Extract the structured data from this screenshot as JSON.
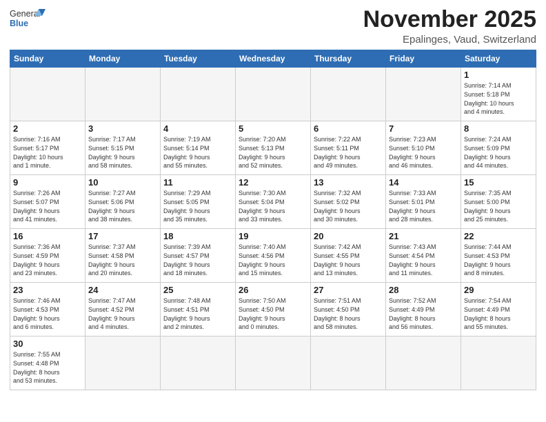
{
  "header": {
    "logo_general": "General",
    "logo_blue": "Blue",
    "month_title": "November 2025",
    "location": "Epalinges, Vaud, Switzerland"
  },
  "days_of_week": [
    "Sunday",
    "Monday",
    "Tuesday",
    "Wednesday",
    "Thursday",
    "Friday",
    "Saturday"
  ],
  "weeks": [
    [
      {
        "day": null,
        "info": ""
      },
      {
        "day": null,
        "info": ""
      },
      {
        "day": null,
        "info": ""
      },
      {
        "day": null,
        "info": ""
      },
      {
        "day": null,
        "info": ""
      },
      {
        "day": null,
        "info": ""
      },
      {
        "day": "1",
        "info": "Sunrise: 7:14 AM\nSunset: 5:18 PM\nDaylight: 10 hours\nand 4 minutes."
      }
    ],
    [
      {
        "day": "2",
        "info": "Sunrise: 7:16 AM\nSunset: 5:17 PM\nDaylight: 10 hours\nand 1 minute."
      },
      {
        "day": "3",
        "info": "Sunrise: 7:17 AM\nSunset: 5:15 PM\nDaylight: 9 hours\nand 58 minutes."
      },
      {
        "day": "4",
        "info": "Sunrise: 7:19 AM\nSunset: 5:14 PM\nDaylight: 9 hours\nand 55 minutes."
      },
      {
        "day": "5",
        "info": "Sunrise: 7:20 AM\nSunset: 5:13 PM\nDaylight: 9 hours\nand 52 minutes."
      },
      {
        "day": "6",
        "info": "Sunrise: 7:22 AM\nSunset: 5:11 PM\nDaylight: 9 hours\nand 49 minutes."
      },
      {
        "day": "7",
        "info": "Sunrise: 7:23 AM\nSunset: 5:10 PM\nDaylight: 9 hours\nand 46 minutes."
      },
      {
        "day": "8",
        "info": "Sunrise: 7:24 AM\nSunset: 5:09 PM\nDaylight: 9 hours\nand 44 minutes."
      }
    ],
    [
      {
        "day": "9",
        "info": "Sunrise: 7:26 AM\nSunset: 5:07 PM\nDaylight: 9 hours\nand 41 minutes."
      },
      {
        "day": "10",
        "info": "Sunrise: 7:27 AM\nSunset: 5:06 PM\nDaylight: 9 hours\nand 38 minutes."
      },
      {
        "day": "11",
        "info": "Sunrise: 7:29 AM\nSunset: 5:05 PM\nDaylight: 9 hours\nand 35 minutes."
      },
      {
        "day": "12",
        "info": "Sunrise: 7:30 AM\nSunset: 5:04 PM\nDaylight: 9 hours\nand 33 minutes."
      },
      {
        "day": "13",
        "info": "Sunrise: 7:32 AM\nSunset: 5:02 PM\nDaylight: 9 hours\nand 30 minutes."
      },
      {
        "day": "14",
        "info": "Sunrise: 7:33 AM\nSunset: 5:01 PM\nDaylight: 9 hours\nand 28 minutes."
      },
      {
        "day": "15",
        "info": "Sunrise: 7:35 AM\nSunset: 5:00 PM\nDaylight: 9 hours\nand 25 minutes."
      }
    ],
    [
      {
        "day": "16",
        "info": "Sunrise: 7:36 AM\nSunset: 4:59 PM\nDaylight: 9 hours\nand 23 minutes."
      },
      {
        "day": "17",
        "info": "Sunrise: 7:37 AM\nSunset: 4:58 PM\nDaylight: 9 hours\nand 20 minutes."
      },
      {
        "day": "18",
        "info": "Sunrise: 7:39 AM\nSunset: 4:57 PM\nDaylight: 9 hours\nand 18 minutes."
      },
      {
        "day": "19",
        "info": "Sunrise: 7:40 AM\nSunset: 4:56 PM\nDaylight: 9 hours\nand 15 minutes."
      },
      {
        "day": "20",
        "info": "Sunrise: 7:42 AM\nSunset: 4:55 PM\nDaylight: 9 hours\nand 13 minutes."
      },
      {
        "day": "21",
        "info": "Sunrise: 7:43 AM\nSunset: 4:54 PM\nDaylight: 9 hours\nand 11 minutes."
      },
      {
        "day": "22",
        "info": "Sunrise: 7:44 AM\nSunset: 4:53 PM\nDaylight: 9 hours\nand 8 minutes."
      }
    ],
    [
      {
        "day": "23",
        "info": "Sunrise: 7:46 AM\nSunset: 4:53 PM\nDaylight: 9 hours\nand 6 minutes."
      },
      {
        "day": "24",
        "info": "Sunrise: 7:47 AM\nSunset: 4:52 PM\nDaylight: 9 hours\nand 4 minutes."
      },
      {
        "day": "25",
        "info": "Sunrise: 7:48 AM\nSunset: 4:51 PM\nDaylight: 9 hours\nand 2 minutes."
      },
      {
        "day": "26",
        "info": "Sunrise: 7:50 AM\nSunset: 4:50 PM\nDaylight: 9 hours\nand 0 minutes."
      },
      {
        "day": "27",
        "info": "Sunrise: 7:51 AM\nSunset: 4:50 PM\nDaylight: 8 hours\nand 58 minutes."
      },
      {
        "day": "28",
        "info": "Sunrise: 7:52 AM\nSunset: 4:49 PM\nDaylight: 8 hours\nand 56 minutes."
      },
      {
        "day": "29",
        "info": "Sunrise: 7:54 AM\nSunset: 4:49 PM\nDaylight: 8 hours\nand 55 minutes."
      }
    ],
    [
      {
        "day": "30",
        "info": "Sunrise: 7:55 AM\nSunset: 4:48 PM\nDaylight: 8 hours\nand 53 minutes."
      },
      {
        "day": null,
        "info": ""
      },
      {
        "day": null,
        "info": ""
      },
      {
        "day": null,
        "info": ""
      },
      {
        "day": null,
        "info": ""
      },
      {
        "day": null,
        "info": ""
      },
      {
        "day": null,
        "info": ""
      }
    ]
  ]
}
